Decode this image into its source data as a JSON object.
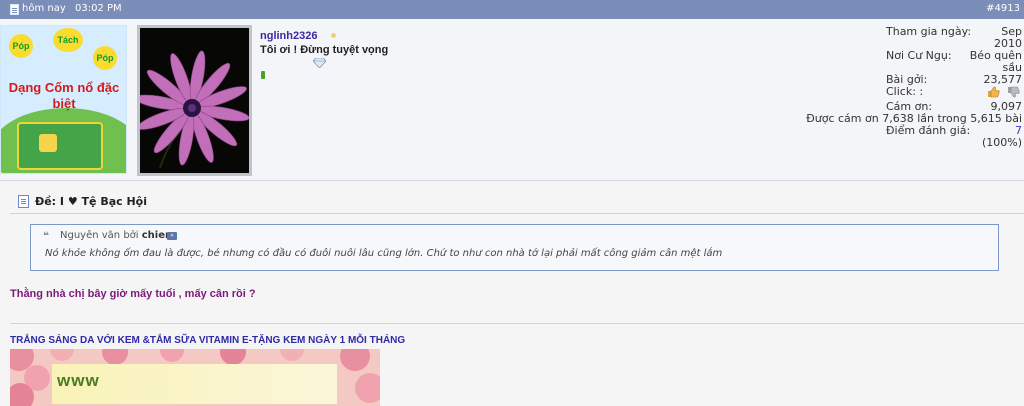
{
  "topbar": {
    "date": "hôm nay",
    "time": "03:02 PM",
    "post_number": "#4913",
    "doc_icon": "document-icon"
  },
  "ad": {
    "pops": [
      "Póp",
      "Tách",
      "Póp"
    ],
    "title": "Dạng Cốm nổ đặc biệt"
  },
  "user": {
    "username": "nglinh2326",
    "title": "Tôi ơi ! Đừng tuyệt vọng",
    "status_color": "#f2d36d",
    "reputation_color": "#47a22a"
  },
  "stats": {
    "join_label": "Tham gia ngày:",
    "join_value_1": "Sep",
    "join_value_2": "2010",
    "location_label": "Nơi Cư Ngụ:",
    "location_value_1": "Béo quên",
    "location_value_2": "sầu",
    "posts_label": "Bài gởi:",
    "posts_value": "23,577",
    "click_label": "Click: :",
    "thanks_label": "Cám ơn:",
    "thanks_value": "9,097",
    "thanked_text": "Được cám ơn 7,638 lần trong 5,615 bài",
    "rating_label": "Điểm đánh giá:",
    "rating_value": "7",
    "rating_percent": "(100%)"
  },
  "post": {
    "title": "Đề: I ♥ Tệ Bạc Hội",
    "quote_header_prefix": "Nguyên văn bởi",
    "quote_author": "chien",
    "quote_text": "Nó khỏe không ốm đau là được, bé nhưng có đầu có đuôi nuôi lâu cũng lớn. Chứ to như con nhà tớ lại phải mất công giảm cân mệt lắm",
    "reply_text": "Thằng nhà chị bây giờ mấy tuổi , mấy cân rồi ?"
  },
  "signature": {
    "link_text": "TRẮNG SÁNG DA VỚI KEM &TẮM SỮA VITAMIN E-TẶNG KEM NGÀY 1 MỖI THÁNG",
    "banner_text": "www"
  }
}
